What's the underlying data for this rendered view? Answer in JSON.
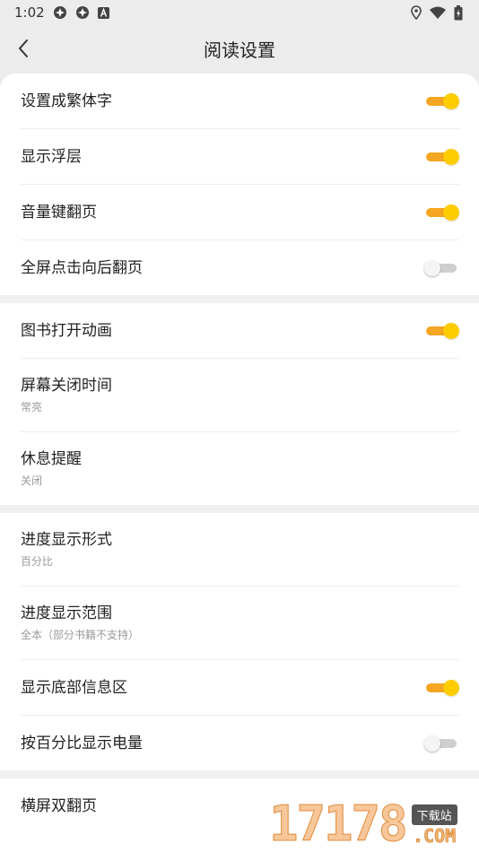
{
  "status_bar": {
    "time": "1:02",
    "left_icons": [
      "app-notification-icon",
      "app-notification-icon",
      "a-badge-icon"
    ],
    "right_icons": [
      "location-icon",
      "wifi-icon",
      "battery-charging-icon"
    ]
  },
  "header": {
    "title": "阅读设置",
    "back_icon": "back-arrow-icon"
  },
  "colors": {
    "accent_track": "#f5a623",
    "accent_knob": "#ffcc00",
    "off_track": "#cfcfcf"
  },
  "sections": [
    {
      "rows": [
        {
          "label": "设置成繁体字",
          "toggle": true
        },
        {
          "label": "显示浮层",
          "toggle": true
        },
        {
          "label": "音量键翻页",
          "toggle": true
        },
        {
          "label": "全屏点击向后翻页",
          "toggle": false
        }
      ]
    },
    {
      "rows": [
        {
          "label": "图书打开动画",
          "toggle": true
        },
        {
          "label": "屏幕关闭时间",
          "value": "常亮"
        },
        {
          "label": "休息提醒",
          "value": "关闭"
        }
      ]
    },
    {
      "rows": [
        {
          "label": "进度显示形式",
          "value": "百分比"
        },
        {
          "label": "进度显示范围",
          "value": "全本（部分书籍不支持）"
        },
        {
          "label": "显示底部信息区",
          "toggle": true
        },
        {
          "label": "按百分比显示电量",
          "toggle": false
        }
      ]
    },
    {
      "rows": [
        {
          "label": "横屏双翻页"
        }
      ]
    }
  ],
  "watermark": {
    "number": "17178",
    "tag": "下载站",
    "domain": ".COM"
  }
}
